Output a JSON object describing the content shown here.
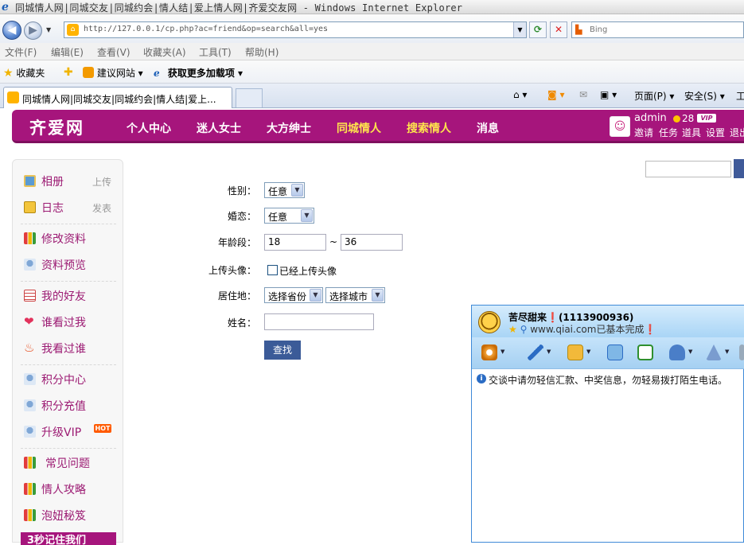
{
  "browser": {
    "title": "同城情人网|同城交友|同城约会|情人结|爱上情人网|齐爱交友网 - Windows Internet Explorer",
    "url": "http://127.0.0.1/cp.php?ac=friend&op=search&all=yes",
    "search_placeholder": "Bing",
    "menu": [
      "文件(F)",
      "编辑(E)",
      "查看(V)",
      "收藏夹(A)",
      "工具(T)",
      "帮助(H)"
    ],
    "favorites": {
      "favorites_label": "收藏夹",
      "suggested_label": "建议网站 ▾",
      "addons_label": "获取更多加载项 ▾"
    },
    "tab_label": "同城情人网|同城交友|同城约会|情人结|爱上...",
    "commands": {
      "page": "页面(P) ▾",
      "safety": "安全(S) ▾",
      "tools": "工"
    }
  },
  "site": {
    "logo": "齐爱网",
    "nav": [
      "个人中心",
      "迷人女士",
      "大方绅士",
      "同城情人",
      "搜索情人",
      "消息"
    ],
    "user": {
      "name": "admin",
      "coins": "28",
      "vip": "VIP",
      "links": [
        "邀请",
        "任务",
        "道具",
        "设置",
        "退出"
      ]
    }
  },
  "sidebar": {
    "items": [
      {
        "label": "相册",
        "side": "上传"
      },
      {
        "label": "日志",
        "side": "发表"
      },
      {
        "label": "修改资料"
      },
      {
        "label": "资料预览"
      },
      {
        "label": "我的好友"
      },
      {
        "label": "谁看过我"
      },
      {
        "label": "我看过谁"
      },
      {
        "label": "积分中心"
      },
      {
        "label": "积分充值"
      },
      {
        "label": "升级VIP",
        "badge": "HOT"
      },
      {
        "label": "常见问题"
      },
      {
        "label": "情人攻略"
      },
      {
        "label": "泡妞秘笈"
      }
    ],
    "banner": "3秒记住我们"
  },
  "form": {
    "gender_label": "性别：",
    "gender_value": "任意",
    "marital_label": "婚恋：",
    "marital_value": "任意",
    "age_label": "年龄段：",
    "age_min": "18",
    "age_sep": "~",
    "age_max": "36",
    "avatar_label": "上传头像：",
    "avatar_check_label": "已经上传头像",
    "residence_label": "居住地：",
    "province_value": "选择省份",
    "city_value": "选择城市",
    "name_label": "姓名：",
    "name_value": "",
    "submit_label": "查找"
  },
  "qq_window": {
    "contact": "苦尽甜来❗(1113900936)",
    "status": "www.qiai.com已基本完成❗",
    "notice": "交谈中请勿轻信汇款、中奖信息，勿轻易拨打陌生电话。"
  }
}
